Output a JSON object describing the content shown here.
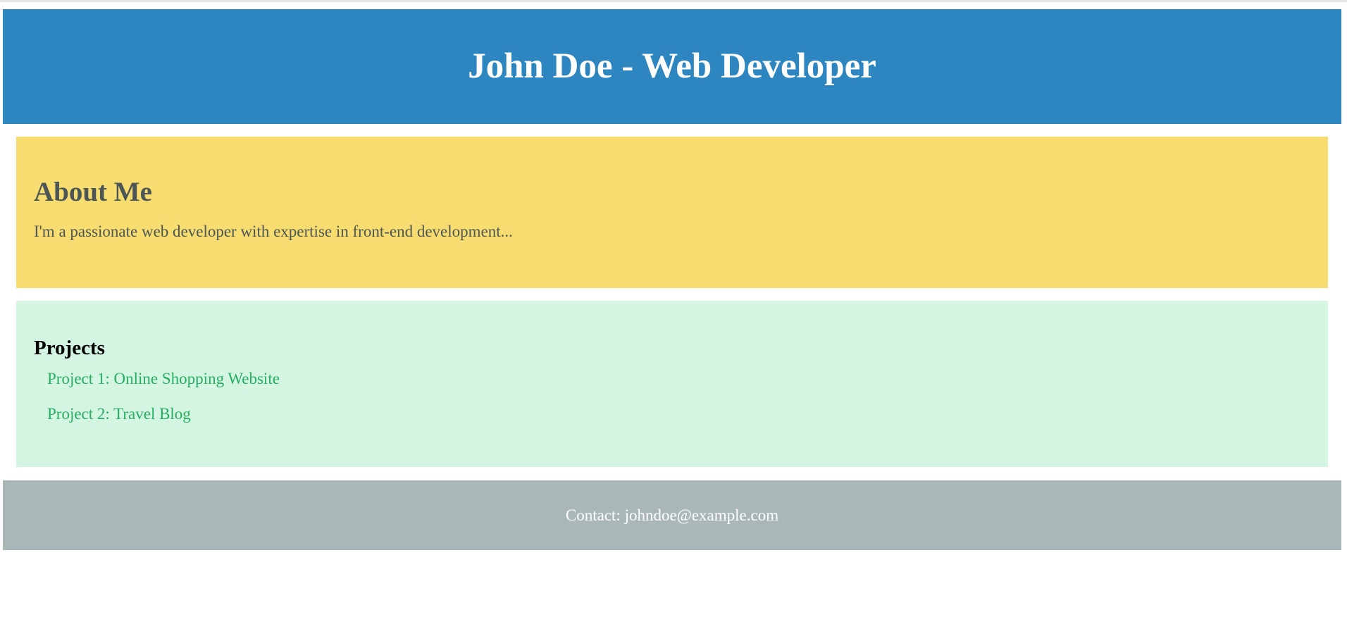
{
  "header": {
    "title": "John Doe - Web Developer"
  },
  "about": {
    "heading": "About Me",
    "text": "I'm a passionate web developer with expertise in front-end development..."
  },
  "projects": {
    "heading": "Projects",
    "items": [
      {
        "label": "Project 1: Online Shopping Website"
      },
      {
        "label": "Project 2: Travel Blog"
      }
    ]
  },
  "footer": {
    "contact": "Contact: johndoe@example.com"
  },
  "colors": {
    "header_bg": "#2e86c1",
    "about_bg": "#f7dc6f",
    "projects_bg": "#d5f5e3",
    "footer_bg": "#aab7b8",
    "link": "#27ae60",
    "text_dark": "#4d5656"
  }
}
